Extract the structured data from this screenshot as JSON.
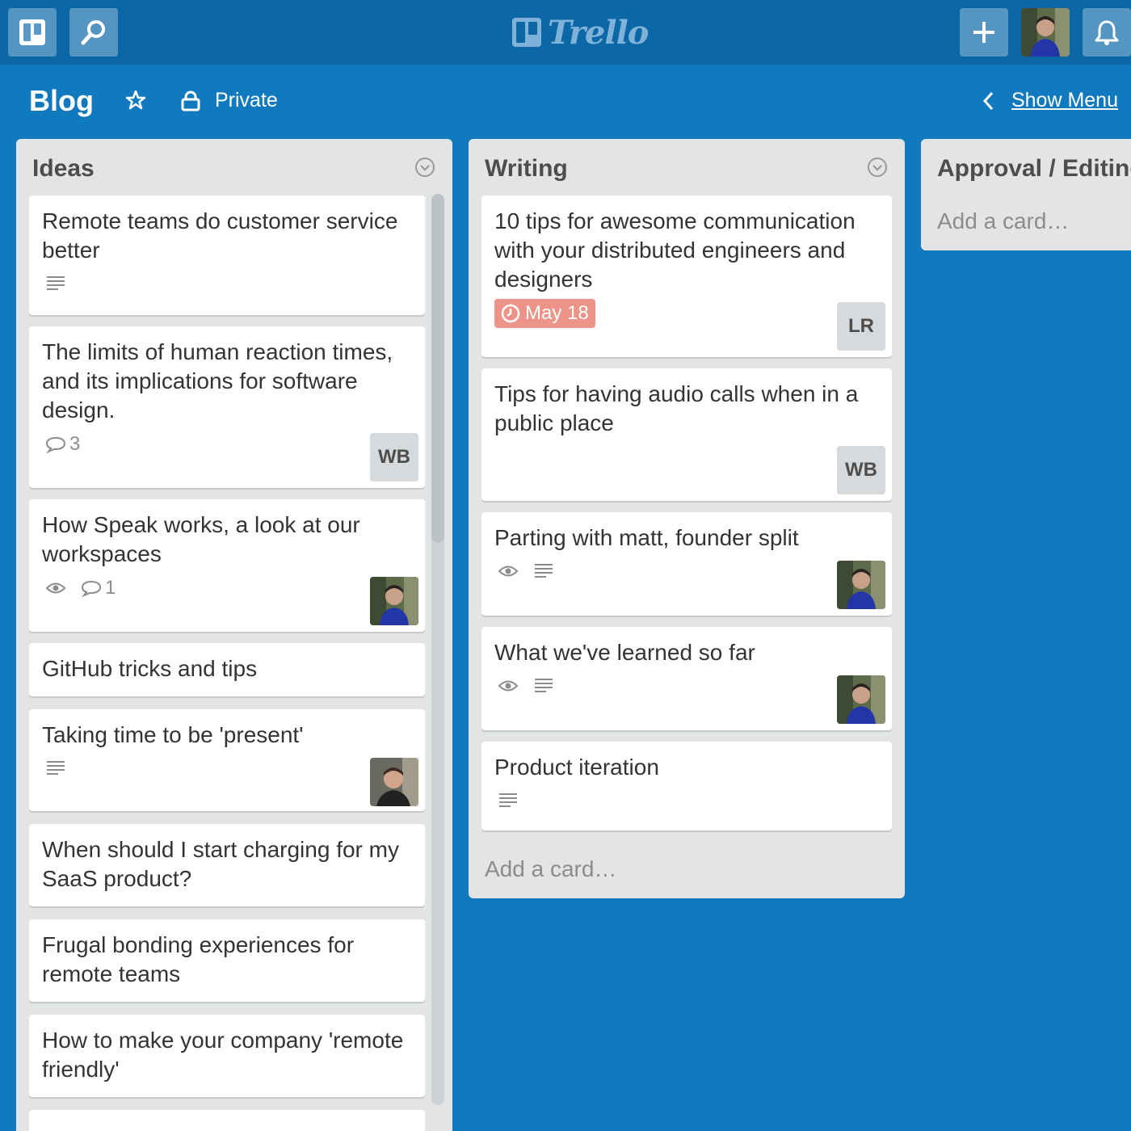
{
  "app": {
    "logo_text": "Trello"
  },
  "header": {
    "boards_icon": "boards-icon",
    "search_icon": "search-icon",
    "add_icon": "plus-icon",
    "notification_icon": "bell-icon"
  },
  "board": {
    "title": "Blog",
    "visibility": "Private",
    "show_menu": "Show Menu"
  },
  "lists": [
    {
      "title": "Ideas",
      "cards": [
        {
          "title": "Remote teams do customer service better",
          "badges": [
            "description"
          ]
        },
        {
          "title": "The limits of human reaction times, and its implications for software design.",
          "comments": "3",
          "member": "WB"
        },
        {
          "title": "How Speak works, a look at our workspaces",
          "comments": "1",
          "watching": true,
          "member": "avatar"
        },
        {
          "title": "GitHub tricks and tips"
        },
        {
          "title": "Taking time to be 'present'",
          "badges": [
            "description"
          ],
          "member": "avatar"
        },
        {
          "title": "When should I start charging for my SaaS product?"
        },
        {
          "title": "Frugal bonding experiences for remote teams"
        },
        {
          "title": "How to make your company 'remote friendly'"
        }
      ]
    },
    {
      "title": "Writing",
      "add_card": "Add a card…",
      "cards": [
        {
          "title": "10 tips for awesome communication with your distributed engineers and designers",
          "due": "May 18",
          "member": "LR"
        },
        {
          "title": "Tips for having audio calls when in a public place",
          "member": "WB"
        },
        {
          "title": "Parting with matt, founder split",
          "watching": true,
          "badges": [
            "description"
          ],
          "member": "avatar"
        },
        {
          "title": "What we've learned so far",
          "watching": true,
          "badges": [
            "description"
          ],
          "member": "avatar"
        },
        {
          "title": "Product iteration",
          "badges": [
            "description"
          ]
        }
      ]
    },
    {
      "title": "Approval / Editing",
      "add_card": "Add a card…"
    }
  ],
  "colors": {
    "board_bg": "#1179be",
    "topbar_bg": "#0b67a6",
    "list_bg": "#e2e4e6",
    "due_badge": "#ec9488"
  }
}
